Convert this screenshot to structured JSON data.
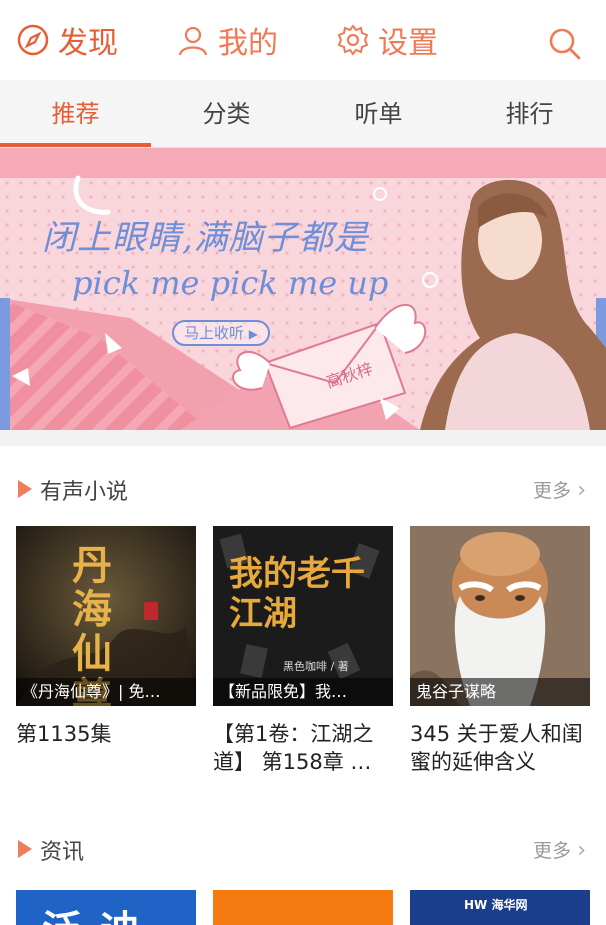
{
  "topnav": {
    "discover": "发现",
    "mine": "我的",
    "settings": "设置"
  },
  "tabs": [
    "推荐",
    "分类",
    "听单",
    "排行"
  ],
  "banner": {
    "headline": "闭上眼睛,满脑子都是",
    "subline": "pick me pick me up",
    "button": "马上收听",
    "envelope_name": "高秋梓"
  },
  "sections": {
    "novel": {
      "title": "有声小说",
      "more": "更多"
    },
    "news": {
      "title": "资讯",
      "more": "更多"
    }
  },
  "cards": [
    {
      "overlay": "《丹海仙尊》| 免…",
      "caption": "第1135集",
      "cover_title": "丹海仙尊"
    },
    {
      "overlay": "【新品限免】我…",
      "caption": "【第1卷：江湖之道】 第158章 …",
      "cover_title": "我的老千江湖",
      "cover_author": "黑色咖啡 / 著"
    },
    {
      "overlay": "鬼谷子谋略",
      "caption": "345 关于爱人和闺蜜的延伸含义"
    }
  ],
  "thumbs": [
    {
      "text": "泛迪"
    },
    {
      "text": ""
    },
    {
      "text": "HW 海华网"
    }
  ],
  "colors": {
    "accent": "#e85d33",
    "banner_pink": "#f7c6cf",
    "banner_blue": "#6f8ed8"
  },
  "icons": {
    "discover": "compass-icon",
    "mine": "person-icon",
    "settings": "gear-icon",
    "search": "search-icon",
    "more": "chevron-right-icon"
  }
}
